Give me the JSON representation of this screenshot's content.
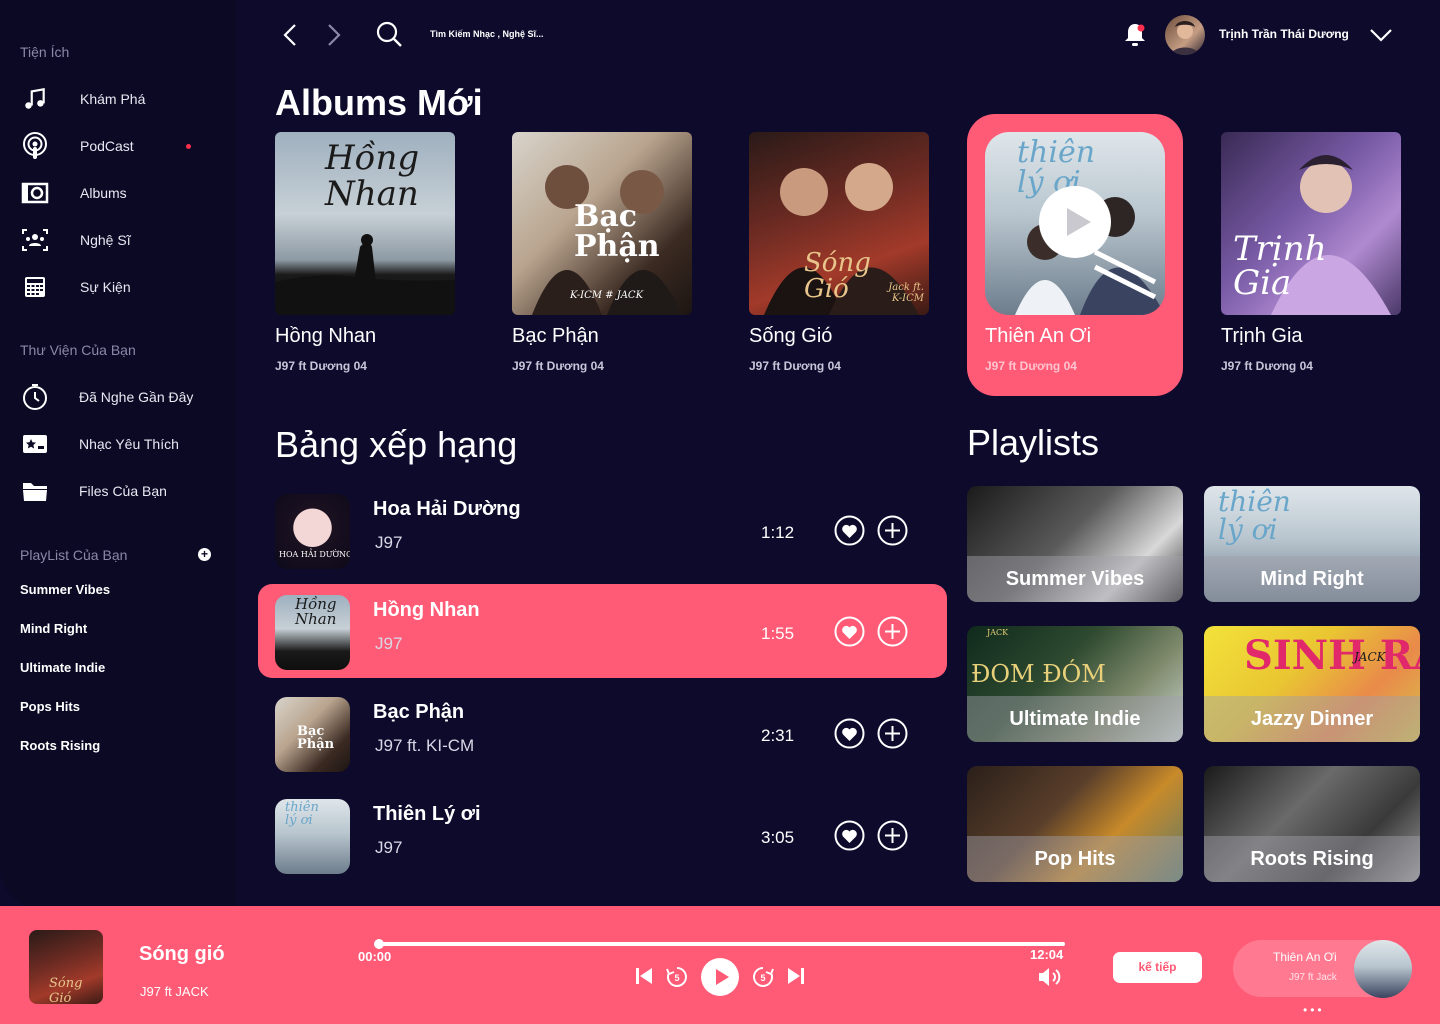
{
  "topbar": {
    "search_placeholder": "Tìm Kiếm Nhạc , Nghệ Sĩ...",
    "user_name": "Trịnh Trần Thái Dương"
  },
  "sidebar": {
    "section1_title": "Tiện Ích",
    "section1_items": [
      {
        "label": "Khám Phá",
        "icon": "music-note-icon"
      },
      {
        "label": "PodCast",
        "icon": "podcast-icon"
      },
      {
        "label": "Albums",
        "icon": "album-icon"
      },
      {
        "label": "Nghệ Sĩ",
        "icon": "artist-icon"
      },
      {
        "label": "Sự Kiện",
        "icon": "calendar-icon"
      }
    ],
    "section2_title": "Thư Viện Của Bạn",
    "section2_items": [
      {
        "label": "Đã Nghe Gần Đây",
        "icon": "clock-icon"
      },
      {
        "label": "Nhạc Yêu Thích",
        "icon": "star-icon"
      },
      {
        "label": "Files Của Bạn",
        "icon": "folder-icon"
      }
    ],
    "section3_title": "PlayList Của Bạn",
    "playlists": [
      "Summer Vibes",
      "Mind Right",
      "Ultimate Indie",
      "Pops Hits",
      "Roots Rising"
    ]
  },
  "albums_section": {
    "title": "Albums Mới",
    "albums": [
      {
        "name": "Hồng Nhan",
        "artist": "J97 ft Dương 04",
        "cover_text": "Hồng Nhan"
      },
      {
        "name": "Bạc Phận",
        "artist": "J97 ft Dương 04",
        "cover_text": "Bạc Phận",
        "cover_sub": "K-ICM # JACK"
      },
      {
        "name": "Sống Gió",
        "artist": "J97 ft Dương 04",
        "cover_text": "Sóng Gió",
        "cover_sub": "Jack ft. K-ICM"
      },
      {
        "name": "Thiên An Ơi",
        "artist": "J97 ft Dương 04",
        "cover_text": "thiên lý ơi",
        "active": true
      },
      {
        "name": "Trịnh Gia",
        "artist": "J97 ft Dương 04",
        "cover_text": "Trịnh Gia"
      }
    ]
  },
  "chart_section": {
    "title": "Bảng xếp hạng",
    "rows": [
      {
        "title": "Hoa Hải Dường",
        "artist": "J97",
        "duration": "1:12",
        "thumb_text": "HOA HẢI DƯỜNG"
      },
      {
        "title": "Hồng Nhan",
        "artist": "J97",
        "duration": "1:55",
        "active": true,
        "thumb_text": "Hồng Nhan"
      },
      {
        "title": "Bạc Phận",
        "artist": "J97 ft. KI-CM",
        "duration": "2:31",
        "thumb_text": "Bạc Phận"
      },
      {
        "title": "Thiên Lý ơi",
        "artist": "J97",
        "duration": "3:05",
        "thumb_text": "thiên lý ơi"
      }
    ]
  },
  "playlists_section": {
    "title": "Playlists",
    "cards": [
      {
        "label": "Summer Vibes"
      },
      {
        "label": "Mind Right",
        "cover_text": "thiên lý ơi"
      },
      {
        "label": "Ultimate Indie",
        "cover_text": "ĐOM ĐÓM",
        "cover_sub": "JACK"
      },
      {
        "label": "Jazzy Dinner",
        "cover_text": "SINH RA",
        "cover_sub": "JACK"
      },
      {
        "label": "Pop Hits"
      },
      {
        "label": "Roots Rising"
      }
    ]
  },
  "player": {
    "title": "Sóng gió",
    "artist": "J97 ft JACK",
    "time_current": "00:00",
    "time_total": "12:04",
    "progress": 0,
    "next_button": "kế tiếp",
    "next_up": {
      "title": "Thiên An Ơi",
      "artist": "J97 ft Jack"
    },
    "cover_text": "Sóng Gió"
  },
  "colors": {
    "background": "#0d0a2c",
    "sidebar": "#0b0924",
    "accent": "#ff5a76",
    "notification": "#ff2e4d"
  }
}
